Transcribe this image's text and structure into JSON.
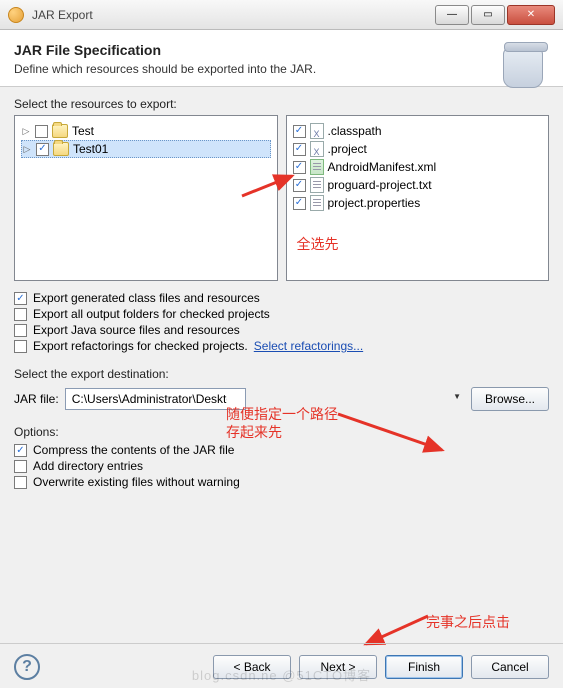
{
  "window": {
    "title": "JAR Export"
  },
  "header": {
    "title": "JAR File Specification",
    "subtitle": "Define which resources should be exported into the JAR."
  },
  "resources_label": "Select the resources to export:",
  "tree": {
    "items": [
      {
        "label": "Test",
        "checked": false
      },
      {
        "label": "Test01",
        "checked": true
      }
    ]
  },
  "files": {
    "items": [
      {
        "label": ".classpath",
        "checked": true,
        "type": "x"
      },
      {
        "label": ".project",
        "checked": true,
        "type": "x"
      },
      {
        "label": "AndroidManifest.xml",
        "checked": true,
        "type": "android"
      },
      {
        "label": "proguard-project.txt",
        "checked": true,
        "type": "txt"
      },
      {
        "label": "project.properties",
        "checked": true,
        "type": "txt"
      }
    ]
  },
  "export_opts": {
    "gen_class": {
      "label": "Export generated class files and resources",
      "checked": true
    },
    "all_out": {
      "label": "Export all output folders for checked projects",
      "checked": false
    },
    "java_src": {
      "label": "Export Java source files and resources",
      "checked": false
    },
    "refactor": {
      "label": "Export refactorings for checked projects.",
      "checked": false
    },
    "refactor_link": "Select refactorings..."
  },
  "dest_label": "Select the export destination:",
  "jar_file_label": "JAR file:",
  "jar_file_value": "C:\\Users\\Administrator\\Desktop\\test.jar",
  "browse_label": "Browse...",
  "options_label": "Options:",
  "options": {
    "compress": {
      "label": "Compress the contents of the JAR file",
      "checked": true
    },
    "adddir": {
      "label": "Add directory entries",
      "checked": false
    },
    "overwrite": {
      "label": "Overwrite existing files without warning",
      "checked": false
    }
  },
  "buttons": {
    "back": "< Back",
    "next": "Next >",
    "finish": "Finish",
    "cancel": "Cancel"
  },
  "annotations": {
    "select_all": "全选先",
    "path_hint1": "随便指定一个路径",
    "path_hint2": "存起来先",
    "finish_hint": "完事之后点击"
  },
  "watermark": "blog.csdn.ne @51CTO博客"
}
